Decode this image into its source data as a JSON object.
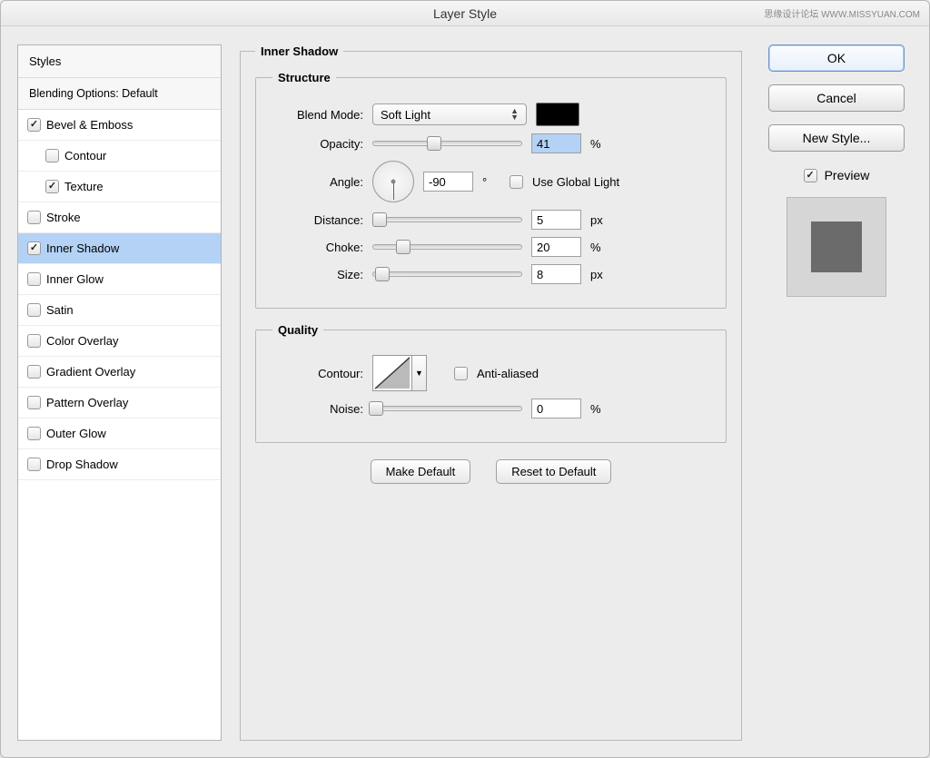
{
  "title": "Layer Style",
  "watermark": "思缘设计论坛 WWW.MISSYUAN.COM",
  "sidebar": {
    "styles_label": "Styles",
    "blending_label": "Blending Options: Default",
    "items": [
      {
        "label": "Bevel & Emboss",
        "checked": true,
        "child": false
      },
      {
        "label": "Contour",
        "checked": false,
        "child": true
      },
      {
        "label": "Texture",
        "checked": true,
        "child": true
      },
      {
        "label": "Stroke",
        "checked": false,
        "child": false
      },
      {
        "label": "Inner Shadow",
        "checked": true,
        "child": false,
        "selected": true
      },
      {
        "label": "Inner Glow",
        "checked": false,
        "child": false
      },
      {
        "label": "Satin",
        "checked": false,
        "child": false
      },
      {
        "label": "Color Overlay",
        "checked": false,
        "child": false
      },
      {
        "label": "Gradient Overlay",
        "checked": false,
        "child": false
      },
      {
        "label": "Pattern Overlay",
        "checked": false,
        "child": false
      },
      {
        "label": "Outer Glow",
        "checked": false,
        "child": false
      },
      {
        "label": "Drop Shadow",
        "checked": false,
        "child": false
      }
    ]
  },
  "panel": {
    "title": "Inner Shadow",
    "structure": {
      "legend": "Structure",
      "blend_mode_label": "Blend Mode:",
      "blend_mode_value": "Soft Light",
      "color": "#000000",
      "opacity_label": "Opacity:",
      "opacity_value": "41",
      "opacity_unit": "%",
      "angle_label": "Angle:",
      "angle_value": "-90",
      "angle_unit": "°",
      "global_light_label": "Use Global Light",
      "global_light_checked": false,
      "distance_label": "Distance:",
      "distance_value": "5",
      "distance_unit": "px",
      "choke_label": "Choke:",
      "choke_value": "20",
      "choke_unit": "%",
      "size_label": "Size:",
      "size_value": "8",
      "size_unit": "px"
    },
    "quality": {
      "legend": "Quality",
      "contour_label": "Contour:",
      "anti_aliased_label": "Anti-aliased",
      "anti_aliased_checked": false,
      "noise_label": "Noise:",
      "noise_value": "0",
      "noise_unit": "%"
    },
    "make_default_label": "Make Default",
    "reset_default_label": "Reset to Default"
  },
  "right": {
    "ok": "OK",
    "cancel": "Cancel",
    "new_style": "New Style...",
    "preview_label": "Preview",
    "preview_checked": true
  }
}
